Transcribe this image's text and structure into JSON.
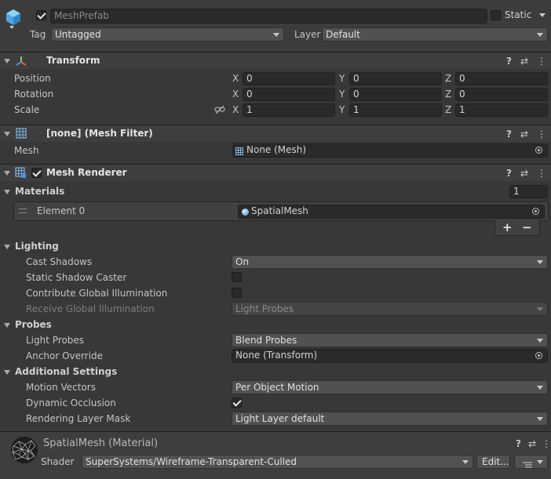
{
  "gameobject": {
    "name": "MeshPrefab",
    "active": true,
    "static_label": "Static",
    "tag_label": "Tag",
    "tag_value": "Untagged",
    "layer_label": "Layer",
    "layer_value": "Default"
  },
  "transform": {
    "title": "Transform",
    "position": {
      "label": "Position",
      "x": "0",
      "y": "0",
      "z": "0"
    },
    "rotation": {
      "label": "Rotation",
      "x": "0",
      "y": "0",
      "z": "0"
    },
    "scale": {
      "label": "Scale",
      "x": "1",
      "y": "1",
      "z": "1"
    },
    "axis": {
      "x": "X",
      "y": "Y",
      "z": "Z"
    }
  },
  "mesh_filter": {
    "title": "[none] (Mesh Filter)",
    "mesh_label": "Mesh",
    "mesh_value": "None (Mesh)"
  },
  "mesh_renderer": {
    "title": "Mesh Renderer",
    "enabled": true,
    "materials_label": "Materials",
    "materials_count": "1",
    "element_label": "Element 0",
    "element_value": "SpatialMesh",
    "plus": "+",
    "minus": "−",
    "lighting": {
      "label": "Lighting",
      "cast_shadows_label": "Cast Shadows",
      "cast_shadows_value": "On",
      "static_shadow_caster_label": "Static Shadow Caster",
      "contribute_gi_label": "Contribute Global Illumination",
      "receive_gi_label": "Receive Global Illumination",
      "receive_gi_value": "Light Probes"
    },
    "probes": {
      "label": "Probes",
      "light_probes_label": "Light Probes",
      "light_probes_value": "Blend Probes",
      "anchor_override_label": "Anchor Override",
      "anchor_override_value": "None (Transform)"
    },
    "additional": {
      "label": "Additional Settings",
      "motion_vectors_label": "Motion Vectors",
      "motion_vectors_value": "Per Object Motion",
      "dynamic_occlusion_label": "Dynamic Occlusion",
      "rendering_layer_mask_label": "Rendering Layer Mask",
      "rendering_layer_mask_value": "Light Layer default"
    }
  },
  "material": {
    "title": "SpatialMesh (Material)",
    "shader_label": "Shader",
    "shader_value": "SuperSystems/Wireframe-Transparent-Culled",
    "edit_label": "Edit..."
  },
  "icons": {
    "help": "?",
    "presets": "⇄",
    "menu": "⋮"
  }
}
